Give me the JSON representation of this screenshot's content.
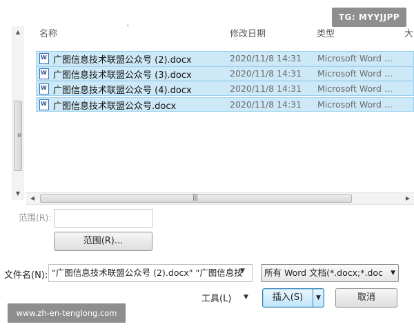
{
  "columns": {
    "name": "名称",
    "date": "修改日期",
    "type": "类型",
    "size": "大"
  },
  "files": [
    {
      "name": "广图信息技术联盟公众号 (2).docx",
      "date": "2020/11/8 14:31",
      "type": "Microsoft Word ..."
    },
    {
      "name": "广图信息技术联盟公众号 (3).docx",
      "date": "2020/11/8 14:31",
      "type": "Microsoft Word ..."
    },
    {
      "name": "广图信息技术联盟公众号 (4).docx",
      "date": "2020/11/8 14:31",
      "type": "Microsoft Word ..."
    },
    {
      "name": "广图信息技术联盟公众号.docx",
      "date": "2020/11/8 14:31",
      "type": "Microsoft Word ..."
    }
  ],
  "range": {
    "label": "范围(R):",
    "button": "范围(R)..."
  },
  "filename": {
    "label": "文件名(N):",
    "value": "\"广图信息技术联盟公众号 (2).docx\" \"广图信息技"
  },
  "filetype": {
    "selected": "所有 Word 文档(*.docx;*.doc"
  },
  "tools_label": "工具(L)",
  "insert_label": "插入(S)",
  "cancel_label": "取消",
  "watermarks": {
    "tg": "TG: MYYJJPP",
    "site": "www.zh-en-tenglong.com"
  },
  "icons": {
    "file": "word-document-icon",
    "dropdown": "triangle-down-icon",
    "scroll_up": "triangle-up-icon",
    "scroll_down": "triangle-down-icon",
    "scroll_left": "triangle-left-icon",
    "scroll_right": "triangle-right-icon"
  },
  "colors": {
    "selection": "#cde8f6",
    "selection_border": "#9bd1ef",
    "primary_button": "#bee6fd"
  }
}
